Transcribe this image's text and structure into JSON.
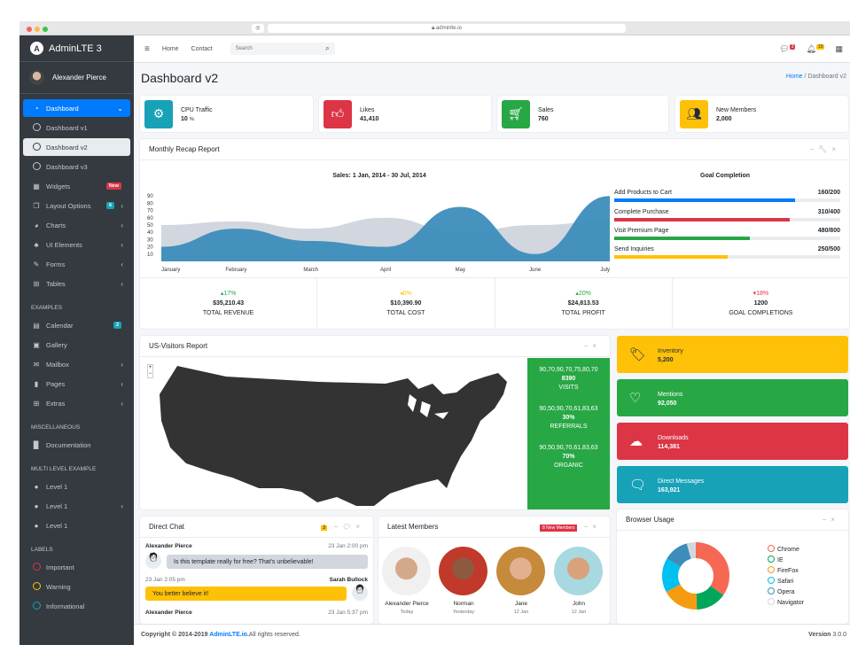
{
  "browser": {
    "url": "adminlte.io"
  },
  "brand": "AdminLTE 3",
  "user": "Alexander Pierce",
  "sidebar": {
    "items": [
      {
        "label": "Dashboard",
        "icon": "dashboard-icon"
      },
      {
        "label": "Dashboard v1"
      },
      {
        "label": "Dashboard v2"
      },
      {
        "label": "Dashboard v3"
      },
      {
        "label": "Widgets",
        "badge": "New"
      },
      {
        "label": "Layout Options",
        "badge": "6"
      },
      {
        "label": "Charts"
      },
      {
        "label": "UI Elements"
      },
      {
        "label": "Forms"
      },
      {
        "label": "Tables"
      }
    ],
    "header_examples": "EXAMPLES",
    "examples": [
      {
        "label": "Calendar",
        "badge": "2"
      },
      {
        "label": "Gallery"
      },
      {
        "label": "Mailbox"
      },
      {
        "label": "Pages"
      },
      {
        "label": "Extras"
      }
    ],
    "header_misc": "MISCELLANEOUS",
    "misc": [
      {
        "label": "Documentation"
      }
    ],
    "header_multi": "MULTI LEVEL EXAMPLE",
    "multi": [
      {
        "label": "Level 1"
      },
      {
        "label": "Level 1"
      },
      {
        "label": "Level 1"
      }
    ],
    "header_labels": "LABELS",
    "labels": [
      {
        "label": "Important",
        "color": "#dc3545"
      },
      {
        "label": "Warning",
        "color": "#ffc107"
      },
      {
        "label": "Informational",
        "color": "#17a2b8"
      }
    ]
  },
  "topnav": {
    "home": "Home",
    "contact": "Contact",
    "search_placeholder": "Search",
    "msg_count": "3",
    "notif_count": "15"
  },
  "page": {
    "title": "Dashboard v2",
    "crumb_home": "Home",
    "crumb_current": "Dashboard v2"
  },
  "infoboxes": [
    {
      "title": "CPU Traffic",
      "value": "10",
      "unit": "%",
      "color": "#17a2b8"
    },
    {
      "title": "Likes",
      "value": "41,410",
      "color": "#dc3545"
    },
    {
      "title": "Sales",
      "value": "760",
      "color": "#28a745"
    },
    {
      "title": "New Members",
      "value": "2,000",
      "color": "#ffc107"
    }
  ],
  "recap": {
    "title": "Monthly Recap Report",
    "sales_title": "Sales: 1 Jan, 2014 - 30 Jul, 2014",
    "goal_title": "Goal Completion",
    "goals": [
      {
        "label": "Add Products to Cart",
        "value": "160/200",
        "pct": 80,
        "color": "#007bff"
      },
      {
        "label": "Complete Purchase",
        "value": "310/400",
        "pct": 77.5,
        "color": "#dc3545"
      },
      {
        "label": "Visit Premium Page",
        "value": "480/800",
        "pct": 60,
        "color": "#28a745"
      },
      {
        "label": "Send Inquiries",
        "value": "250/500",
        "pct": 50,
        "color": "#ffc107"
      }
    ],
    "stats": [
      {
        "change": "17%",
        "dir": "up",
        "color": "#28a745",
        "value": "$35,210.43",
        "label": "TOTAL REVENUE"
      },
      {
        "change": "0%",
        "dir": "left",
        "color": "#ffc107",
        "value": "$10,390.90",
        "label": "TOTAL COST"
      },
      {
        "change": "20%",
        "dir": "up",
        "color": "#28a745",
        "value": "$24,813.53",
        "label": "TOTAL PROFIT"
      },
      {
        "change": "18%",
        "dir": "down",
        "color": "#dc3545",
        "value": "1200",
        "label": "GOAL COMPLETIONS"
      }
    ]
  },
  "chart_data": {
    "type": "area",
    "title": "Sales: 1 Jan, 2014 - 30 Jul, 2014",
    "categories": [
      "January",
      "February",
      "March",
      "April",
      "May",
      "June",
      "July"
    ],
    "yticks": [
      10,
      20,
      30,
      40,
      50,
      60,
      70,
      80,
      90
    ],
    "series": [
      {
        "values": [
          50,
          55,
          45,
          60,
          40,
          50,
          55
        ],
        "color": "#d2d6de"
      },
      {
        "values": [
          20,
          45,
          28,
          20,
          75,
          10,
          90
        ],
        "color": "#3c8dbc"
      }
    ]
  },
  "visitors": {
    "title": "US-Visitors Report",
    "stats": [
      {
        "spark": "90,70,90,70,75,80,70",
        "value": "8390",
        "label": "VISITS"
      },
      {
        "spark": "90,50,90,70,61,83,63",
        "value": "30%",
        "label": "REFERRALS"
      },
      {
        "spark": "90,50,90,70,61,83,63",
        "value": "70%",
        "label": "ORGANIC"
      }
    ]
  },
  "bigboxes": [
    {
      "title": "Inventory",
      "value": "5,200",
      "color": "#ffc107",
      "text": "#1f2d3d"
    },
    {
      "title": "Mentions",
      "value": "92,050",
      "color": "#28a745",
      "text": "#fff"
    },
    {
      "title": "Downloads",
      "value": "114,381",
      "color": "#dc3545",
      "text": "#fff"
    },
    {
      "title": "Direct Messages",
      "value": "163,921",
      "color": "#17a2b8",
      "text": "#fff"
    }
  ],
  "chat": {
    "title": "Direct Chat",
    "badge": "3",
    "messages": [
      {
        "name": "Alexander Pierce",
        "time": "23 Jan 2:00 pm",
        "text": "Is this template really for free? That's unbelievable!"
      },
      {
        "name": "Sarah Bullock",
        "time": "23 Jan 2:05 pm",
        "text": "You better believe it!"
      },
      {
        "name": "Alexander Pierce",
        "time": "23 Jan 5:37 pm"
      }
    ]
  },
  "members": {
    "title": "Latest Members",
    "badge": "8 New Members",
    "list": [
      {
        "name": "Alexander Pierce",
        "date": "Today"
      },
      {
        "name": "Norman",
        "date": "Yesterday"
      },
      {
        "name": "Jane",
        "date": "12 Jan"
      },
      {
        "name": "John",
        "date": "12 Jan"
      }
    ]
  },
  "browser_usage": {
    "title": "Browser Usage",
    "legend": [
      {
        "name": "Chrome",
        "color": "#f56954"
      },
      {
        "name": "IE",
        "color": "#00a65a"
      },
      {
        "name": "FireFox",
        "color": "#f39c12"
      },
      {
        "name": "Safari",
        "color": "#00c0ef"
      },
      {
        "name": "Opera",
        "color": "#3c8dbc"
      },
      {
        "name": "Navigator",
        "color": "#d2d6de"
      }
    ]
  },
  "footer": {
    "copy": "Copyright © 2014-2019 ",
    "link": "AdminLTE.io.",
    "rights": " All rights reserved.",
    "version_label": "Version",
    "version": "3.0.0"
  }
}
